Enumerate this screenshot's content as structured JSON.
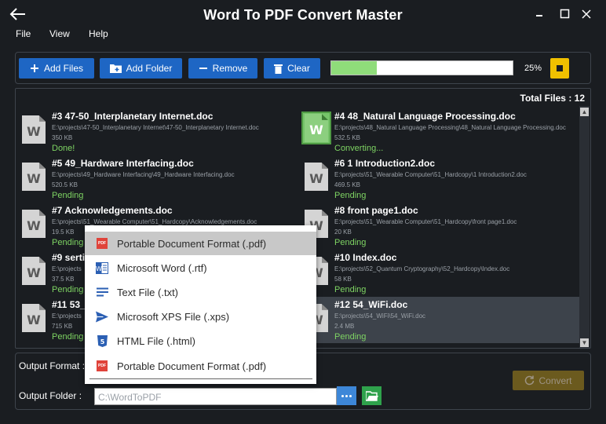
{
  "app": {
    "title": "Word To PDF Convert Master"
  },
  "menu": [
    "File",
    "View",
    "Help"
  ],
  "toolbar": {
    "add_files": "Add Files",
    "add_folder": "Add Folder",
    "remove": "Remove",
    "clear": "Clear",
    "progress_percent": 25,
    "progress_label": "25%"
  },
  "list": {
    "total_label": "Total Files : 12",
    "files": [
      {
        "name": "#3 47-50_Interplanetary Internet.doc",
        "path": "E:\\projects\\47-50_Interplanetary Internet\\47-50_Interplanetary Internet.doc",
        "size": "350 KB",
        "status": "Done!"
      },
      {
        "name": "#4 48_Natural Language Processing.doc",
        "path": "E:\\projects\\48_Natural Language Processing\\48_Natural Language Processing.doc",
        "size": "532.5 KB",
        "status": "Converting..."
      },
      {
        "name": "#5 49_Hardware Interfacing.doc",
        "path": "E:\\projects\\49_Hardware Interfacing\\49_Hardware Interfacing.doc",
        "size": "520.5 KB",
        "status": "Pending"
      },
      {
        "name": "#6 1 Introduction2.doc",
        "path": "E:\\projects\\51_Wearable Computer\\51_Hardcopy\\1 Introduction2.doc",
        "size": "469.5 KB",
        "status": "Pending"
      },
      {
        "name": "#7 Acknowledgements.doc",
        "path": "E:\\projects\\51_Wearable Computer\\51_Hardcopy\\Acknowledgements.doc",
        "size": "19.5 KB",
        "status": "Pending"
      },
      {
        "name": "#8 front page1.doc",
        "path": "E:\\projects\\51_Wearable Computer\\51_Hardcopy\\front page1.doc",
        "size": "20 KB",
        "status": "Pending"
      },
      {
        "name": "#9 sertifi",
        "path": "E:\\projects",
        "size": "37.5 KB",
        "status": "Pending"
      },
      {
        "name": "#10 Index.doc",
        "path": "E:\\projects\\52_Quantum Cryptography\\52_Hardcopy\\Index.doc",
        "size": "58 KB",
        "status": "Pending"
      },
      {
        "name": "#11 53_",
        "path": "E:\\projects",
        "size": "715 KB",
        "status": "Pending"
      },
      {
        "name": "#12 54_WiFi.doc",
        "path": "E:\\projects\\54_WiFi\\54_WiFi.doc",
        "size": "2.4 MB",
        "status": "Pending"
      }
    ]
  },
  "bottom": {
    "output_format_label": "Output Format :",
    "output_folder_label": "Output Folder :",
    "output_folder_value": "C:\\WordToPDF",
    "convert": "Convert"
  },
  "dropdown": {
    "items": [
      {
        "label": "Portable Document Format (.pdf)",
        "icon": "pdf-icon"
      },
      {
        "label": "Microsoft Word (.rtf)",
        "icon": "word-icon"
      },
      {
        "label": "Text File (.txt)",
        "icon": "text-lines-icon"
      },
      {
        "label": "Microsoft XPS File (.xps)",
        "icon": "send-arrow-icon"
      },
      {
        "label": "HTML File (.html)",
        "icon": "html5-icon"
      },
      {
        "label": "Portable Document Format (.pdf)",
        "icon": "pdf-icon"
      }
    ]
  },
  "colors": {
    "accent_blue": "#1e66c4",
    "status_green": "#7ed463",
    "stop_yellow": "#f0c000",
    "progress_green": "#8fdc7a"
  }
}
